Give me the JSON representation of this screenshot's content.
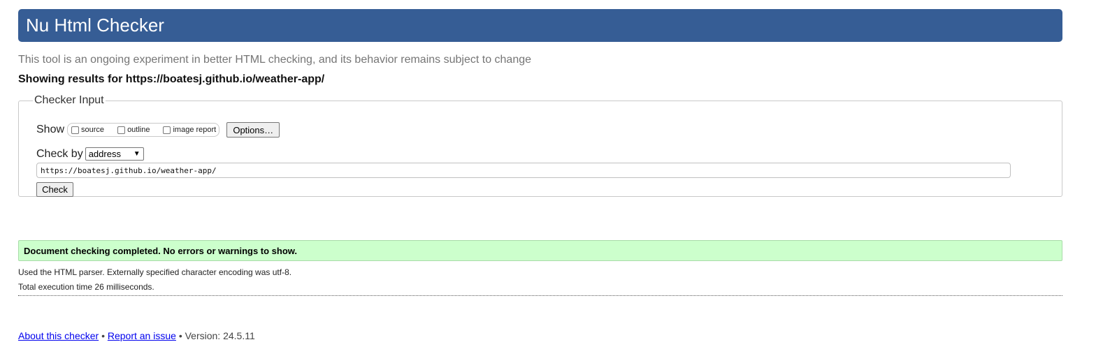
{
  "header": {
    "title": "Nu Html Checker"
  },
  "subtitle": "This tool is an ongoing experiment in better HTML checking, and its behavior remains subject to change",
  "results_for": "Showing results for https://boatesj.github.io/weather-app/",
  "checker_input": {
    "legend": "Checker Input",
    "show_label": "Show",
    "show_options": [
      {
        "label": "source",
        "checked": false
      },
      {
        "label": "outline",
        "checked": false
      },
      {
        "label": "image report",
        "checked": false
      }
    ],
    "options_button": "Options…",
    "check_by_label": "Check by",
    "check_by_value": "address",
    "url_value": "https://boatesj.github.io/weather-app/",
    "check_button": "Check"
  },
  "result": {
    "message": "Document checking completed. No errors or warnings to show.",
    "parser_info": "Used the HTML parser. Externally specified character encoding was utf-8.",
    "execution_time": "Total execution time 26 milliseconds."
  },
  "footer": {
    "about_link": "About this checker",
    "separator": "•",
    "report_link": "Report an issue",
    "version": "Version: 24.5.11"
  },
  "colors": {
    "banner": "#365d95",
    "success_bg": "#ccffcc",
    "link": "#0000ee"
  }
}
